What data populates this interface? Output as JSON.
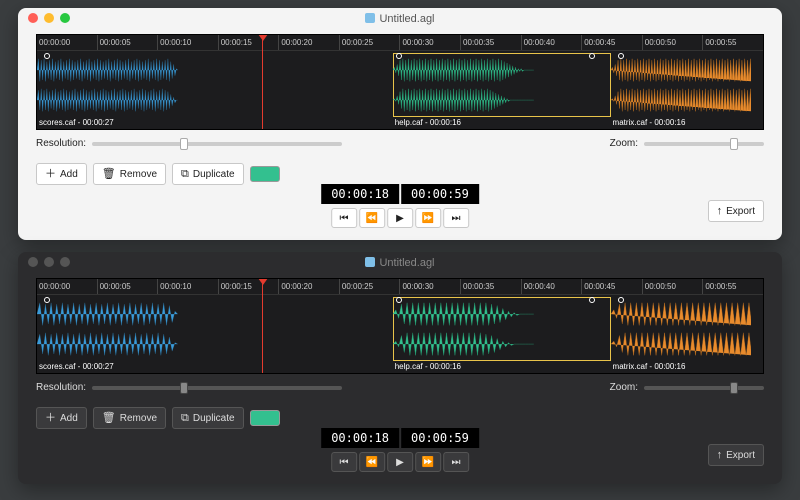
{
  "window": {
    "title": "Untitled.agl"
  },
  "timeline": {
    "ticks": [
      "00:00:00",
      "00:00:05",
      "00:00:10",
      "00:00:15",
      "00:00:20",
      "00:00:25",
      "00:00:30",
      "00:00:35",
      "00:00:40",
      "00:00:45",
      "00:00:50",
      "00:00:55"
    ],
    "playhead_percent": 31,
    "clips": [
      {
        "id": "clip-blue",
        "file": "scores.caf",
        "duration": "00:00:27",
        "color": "#3a9bd9",
        "label": "scores.caf - 00:00:27"
      },
      {
        "id": "clip-green",
        "file": "help.caf",
        "duration": "00:00:16",
        "color": "#33c08f",
        "label": "help.caf - 00:00:16",
        "selected": true
      },
      {
        "id": "clip-orange",
        "file": "matrix.caf",
        "duration": "00:00:16",
        "color": "#e88b2d",
        "label": "matrix.caf - 00:00:16"
      }
    ]
  },
  "sliders": {
    "resolution_label": "Resolution:",
    "resolution_percent": 35,
    "zoom_label": "Zoom:",
    "zoom_percent": 72
  },
  "buttons": {
    "add": "Add",
    "remove": "Remove",
    "duplicate": "Duplicate",
    "export": "Export"
  },
  "swatch_color": "#33c08f",
  "transport": {
    "current": "00:00:18",
    "total": "00:00:59",
    "icons": {
      "skip_start": "skip-start-icon",
      "prev": "prev-icon",
      "play": "play-icon",
      "next": "next-icon",
      "skip_end": "skip-end-icon"
    }
  },
  "icons": {
    "add": "plus-icon",
    "remove": "trash-icon",
    "duplicate": "duplicate-icon",
    "export": "upload-icon"
  }
}
